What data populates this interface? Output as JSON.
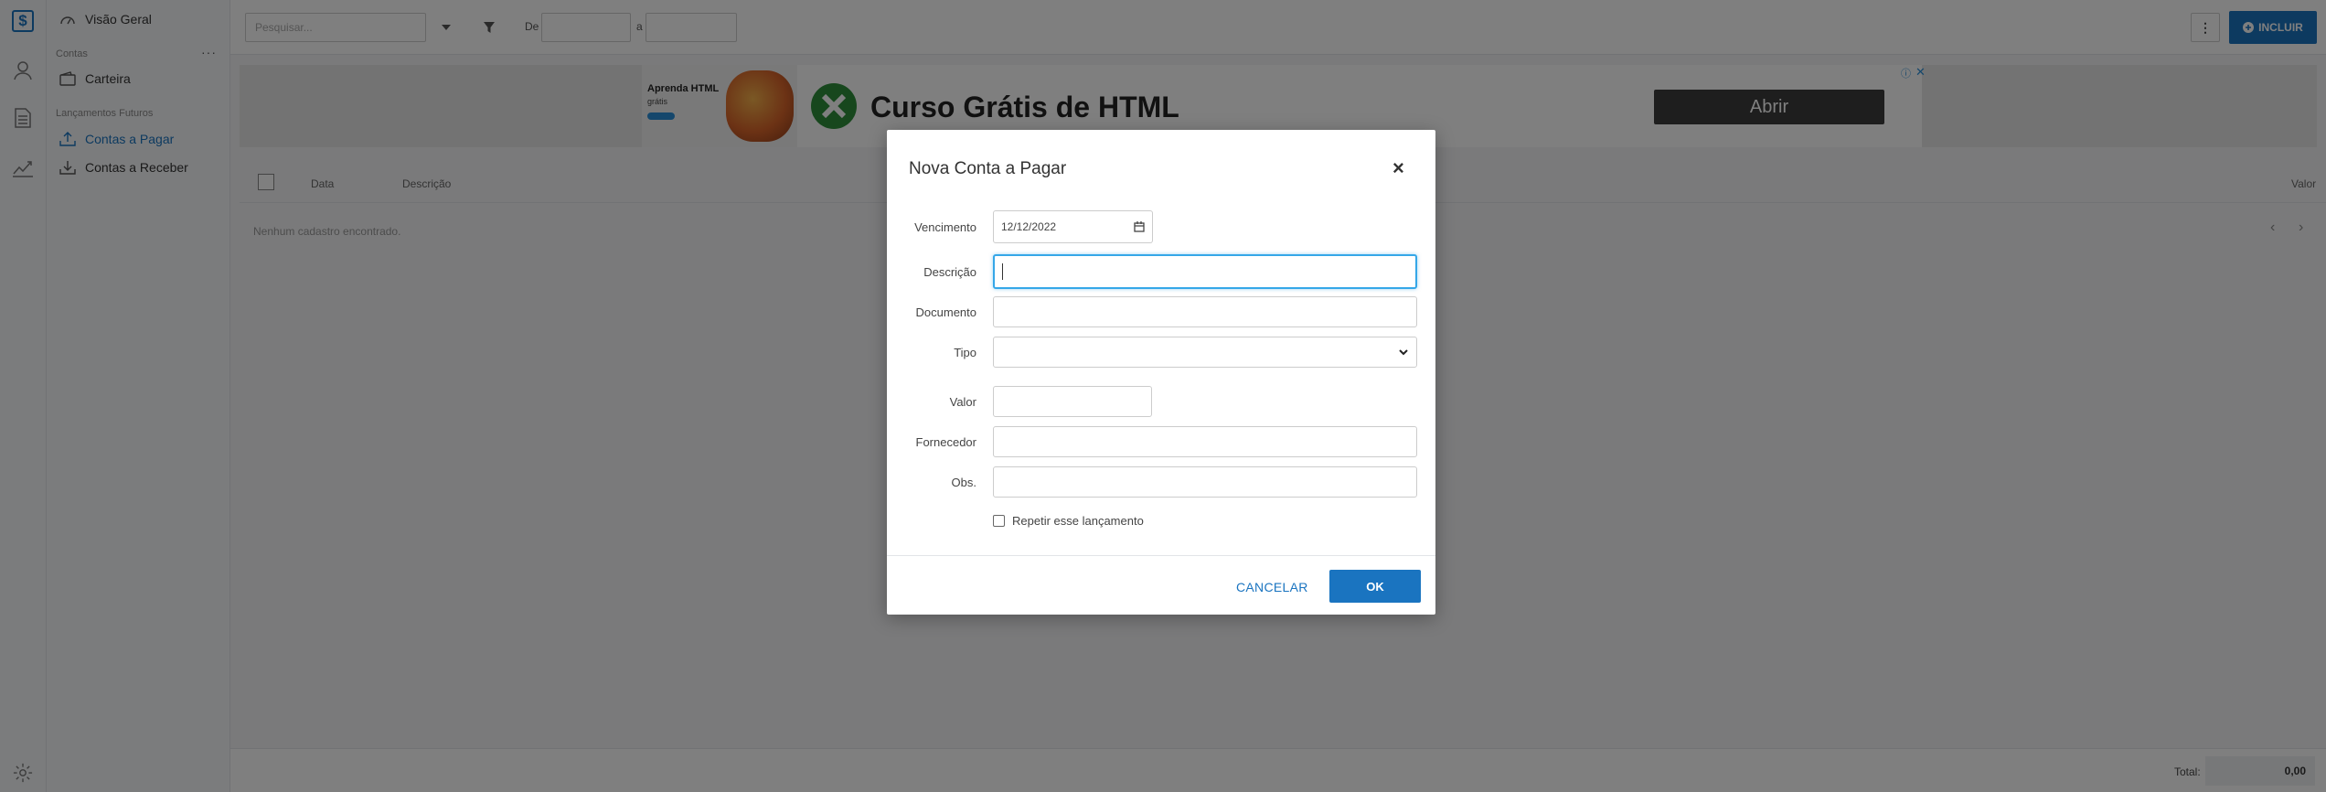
{
  "sidebar": {
    "overview": "Visão Geral",
    "section_contas": "Contas",
    "more_label": "···",
    "carteira": "Carteira",
    "section_futuros": "Lançamentos Futuros",
    "contas_pagar": "Contas a Pagar",
    "contas_receber": "Contas a Receber",
    "logo_glyph": "$"
  },
  "toolbar": {
    "search_placeholder": "Pesquisar...",
    "de_label": "De",
    "a_label": "a",
    "kebab": "⋮",
    "incluir_label": "INCLUIR"
  },
  "ad": {
    "thumb_title": "Aprenda HTML",
    "thumb_sub": "grátis",
    "title": "Curso Grátis de HTML",
    "button": "Abrir"
  },
  "list": {
    "col_data": "Data",
    "col_descricao": "Descrição",
    "col_valor": "Valor",
    "empty_message": "Nenhum cadastro encontrado."
  },
  "footer": {
    "total_label": "Total:",
    "total_value": "0,00"
  },
  "modal": {
    "title": "Nova Conta a Pagar",
    "close": "×",
    "vencimento_label": "Vencimento",
    "vencimento_value": "12/12/2022",
    "descricao_label": "Descrição",
    "documento_label": "Documento",
    "tipo_label": "Tipo",
    "valor_label": "Valor",
    "fornecedor_label": "Fornecedor",
    "obs_label": "Obs.",
    "repeat_label": "Repetir esse lançamento",
    "cancel_label": "CANCELAR",
    "ok_label": "OK"
  },
  "colors": {
    "accent": "#1a74c0",
    "focus": "#35a7e8",
    "ad_logo": "#2f8f3a"
  }
}
